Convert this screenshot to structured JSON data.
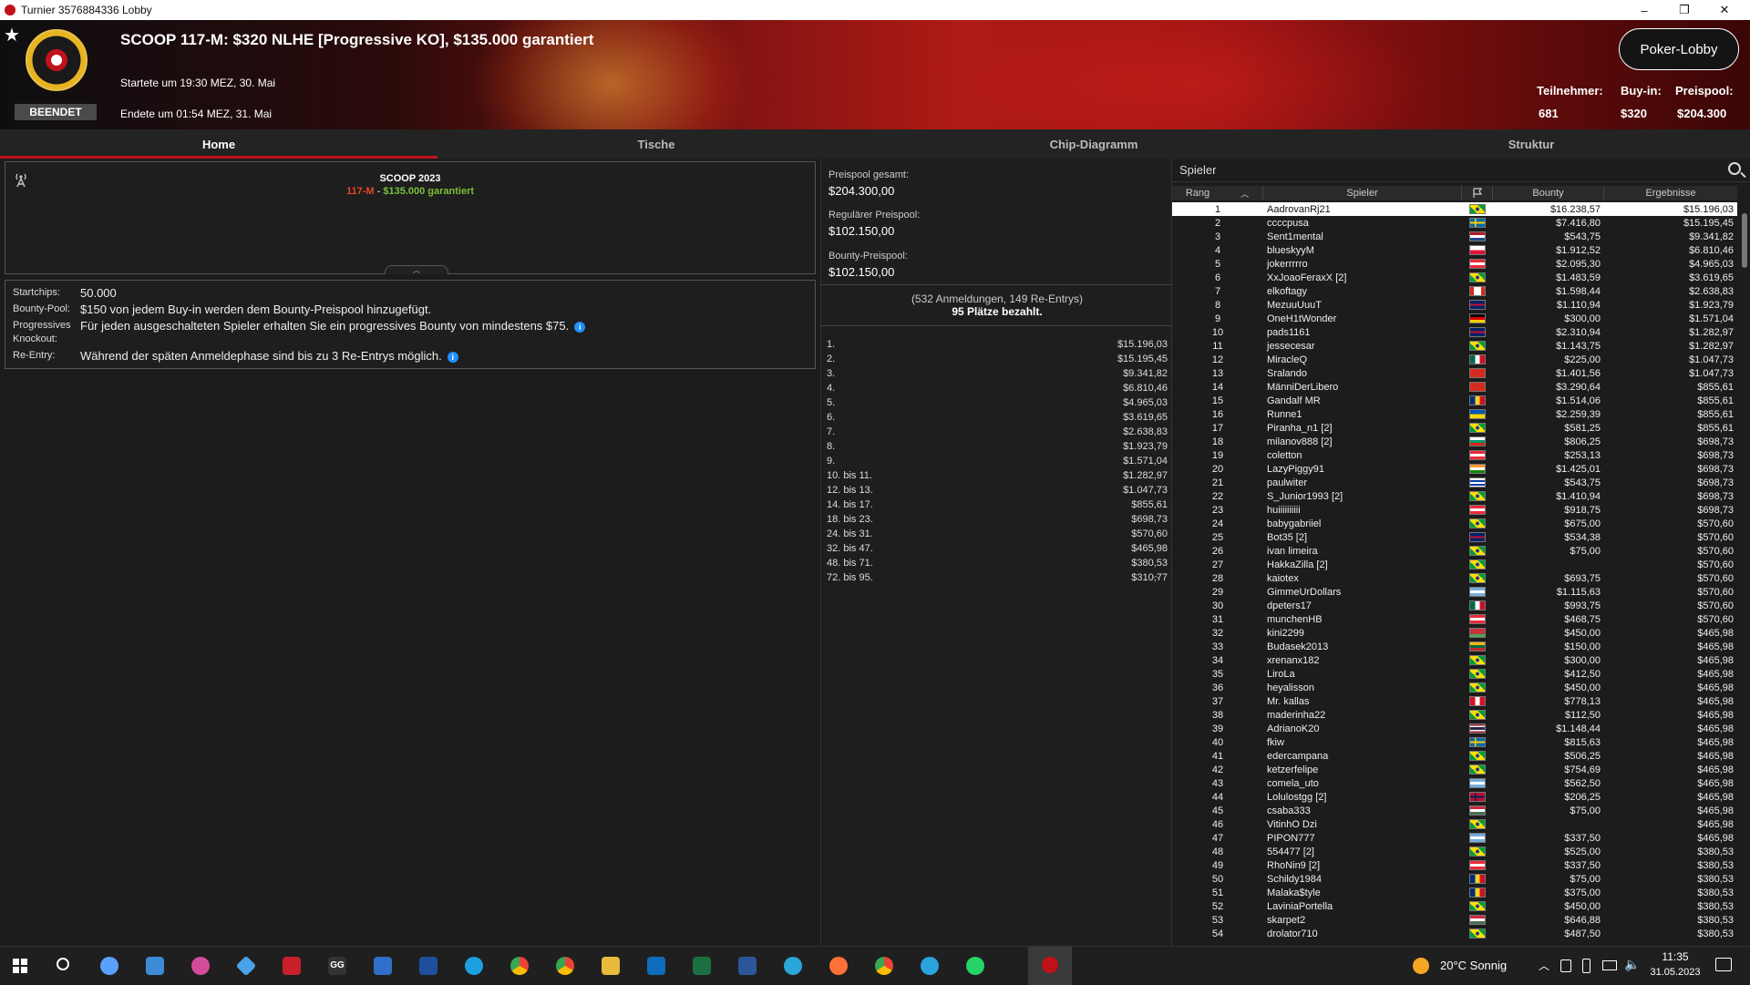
{
  "window": {
    "title": "Turnier 3576884336 Lobby",
    "minimize": "–",
    "maximize": "❐",
    "close": "✕"
  },
  "header": {
    "star": "★",
    "status": "BEENDET",
    "title": "SCOOP 117-M: $320 NLHE [Progressive KO], $135.000 garantiert",
    "started": "Startete um 19:30 MEZ, 30. Mai",
    "ended": "Endete um 01:54 MEZ, 31. Mai",
    "lobby_button": "Poker-Lobby",
    "stats": {
      "participants_label": "Teilnehmer:",
      "participants": "681",
      "buyin_label": "Buy-in:",
      "buyin": "$320",
      "prizepool_label": "Preispool:",
      "prizepool": "$204.300"
    }
  },
  "tabs": [
    "Home",
    "Tische",
    "Chip-Diagramm",
    "Struktur"
  ],
  "series": {
    "name": "SCOOP 2023",
    "event": "117-M",
    "sep": " - ",
    "guarantee": "$135.000 garantiert"
  },
  "details": [
    {
      "label": "Startchips:",
      "value": "50.000",
      "info": false
    },
    {
      "label": "Bounty-Pool:",
      "value": "$150 von jedem Buy-in werden dem Bounty-Preispool hinzugefügt.",
      "info": false
    },
    {
      "label": "Progressives Knockout:",
      "value": "Für jeden ausgeschalteten Spieler erhalten Sie ein progressives Bounty von mindestens $75.",
      "info": true
    },
    {
      "label": "Re-Entry:",
      "value": "Während der späten Anmeldephase sind bis zu 3 Re-Entrys möglich.",
      "info": true
    }
  ],
  "info_glyph": "i",
  "prizepool": {
    "total_label": "Preispool gesamt:",
    "total": "$204.300,00",
    "regular_label": "Regulärer Preispool:",
    "regular": "$102.150,00",
    "bounty_label": "Bounty-Preispool:",
    "bounty": "$102.150,00",
    "registrations": "(532 Anmeldungen, 149 Re-Entrys)",
    "paid": "95 Plätze bezahlt."
  },
  "payouts": [
    [
      "1.",
      "$15.196,03"
    ],
    [
      "2.",
      "$15.195,45"
    ],
    [
      "3.",
      "$9.341,82"
    ],
    [
      "4.",
      "$6.810,46"
    ],
    [
      "5.",
      "$4.965,03"
    ],
    [
      "6.",
      "$3.619,65"
    ],
    [
      "7.",
      "$2.638,83"
    ],
    [
      "8.",
      "$1.923,79"
    ],
    [
      "9.",
      "$1.571,04"
    ],
    [
      "10. bis 11.",
      "$1.282,97"
    ],
    [
      "12. bis 13.",
      "$1.047,73"
    ],
    [
      "14. bis 17.",
      "$855,61"
    ],
    [
      "18. bis 23.",
      "$698,73"
    ],
    [
      "24. bis 31.",
      "$570,60"
    ],
    [
      "32. bis 47.",
      "$465,98"
    ],
    [
      "48. bis 71.",
      "$380,53"
    ],
    [
      "72. bis 95.",
      "$310,77"
    ]
  ],
  "players_panel": {
    "title": "Spieler",
    "columns": [
      "Rang",
      "Spieler",
      "",
      "Bounty",
      "Ergebnisse"
    ]
  },
  "players": [
    [
      "1",
      "AadrovanRj21",
      "br",
      "$16.238,57",
      "$15.196,03"
    ],
    [
      "2",
      "ccccpusa",
      "se",
      "$7.416,80",
      "$15.195,45"
    ],
    [
      "3",
      "Sent1mental",
      "nl",
      "$543,75",
      "$9.341,82"
    ],
    [
      "4",
      "blueskyyM",
      "pl",
      "$1.912,52",
      "$6.810,46"
    ],
    [
      "5",
      "jokerrrrro",
      "at",
      "$2.095,30",
      "$4.965,03"
    ],
    [
      "6",
      "XxJoaoFeraxX [2]",
      "br",
      "$1.483,59",
      "$3.619,65"
    ],
    [
      "7",
      "elkoftagy",
      "ca",
      "$1.598,44",
      "$2.638,83"
    ],
    [
      "8",
      "MezuuUuuT",
      "gb",
      "$1.110,94",
      "$1.923,79"
    ],
    [
      "9",
      "OneH1tWonder",
      "de",
      "$300,00",
      "$1.571,04"
    ],
    [
      "10",
      "pads1161",
      "gb",
      "$2.310,94",
      "$1.282,97"
    ],
    [
      "11",
      "jessecesar",
      "br",
      "$1.143,75",
      "$1.282,97"
    ],
    [
      "12",
      "MiracleQ",
      "mx",
      "$225,00",
      "$1.047,73"
    ],
    [
      "13",
      "Sralando",
      "ch",
      "$1.401,56",
      "$1.047,73"
    ],
    [
      "14",
      "MänniDerLibero",
      "ch",
      "$3.290,64",
      "$855,61"
    ],
    [
      "15",
      "Gandalf MR",
      "ro",
      "$1.514,06",
      "$855,61"
    ],
    [
      "16",
      "Runne1",
      "ua",
      "$2.259,39",
      "$855,61"
    ],
    [
      "17",
      "Piranha_n1 [2]",
      "br",
      "$581,25",
      "$855,61"
    ],
    [
      "18",
      "milanov888 [2]",
      "bg",
      "$806,25",
      "$698,73"
    ],
    [
      "19",
      "coletton",
      "at",
      "$253,13",
      "$698,73"
    ],
    [
      "20",
      "LazyPiggy91",
      "in",
      "$1.425,01",
      "$698,73"
    ],
    [
      "21",
      "paulwiter",
      "uy",
      "$543,75",
      "$698,73"
    ],
    [
      "22",
      "S_Junior1993 [2]",
      "br",
      "$1.410,94",
      "$698,73"
    ],
    [
      "23",
      "huiiiiiiiiii",
      "at",
      "$918,75",
      "$698,73"
    ],
    [
      "24",
      "babygabriiel",
      "br",
      "$675,00",
      "$570,60"
    ],
    [
      "25",
      "Bot35 [2]",
      "gb",
      "$534,38",
      "$570,60"
    ],
    [
      "26",
      "ivan limeira",
      "br",
      "$75,00",
      "$570,60"
    ],
    [
      "27",
      "HakkaZilla [2]",
      "br",
      "",
      "$570,60"
    ],
    [
      "28",
      "kaiotex",
      "br",
      "$693,75",
      "$570,60"
    ],
    [
      "29",
      "GimmeUrDollars",
      "ar",
      "$1.115,63",
      "$570,60"
    ],
    [
      "30",
      "dpeters17",
      "mx",
      "$993,75",
      "$570,60"
    ],
    [
      "31",
      "munchenHB",
      "at",
      "$468,75",
      "$570,60"
    ],
    [
      "32",
      "kini2299",
      "by",
      "$450,00",
      "$465,98"
    ],
    [
      "33",
      "Budasek2013",
      "lt",
      "$150,00",
      "$465,98"
    ],
    [
      "34",
      "xrenanx182",
      "br",
      "$300,00",
      "$465,98"
    ],
    [
      "35",
      "LiroLa",
      "br",
      "$412,50",
      "$465,98"
    ],
    [
      "36",
      "heyalisson",
      "br",
      "$450,00",
      "$465,98"
    ],
    [
      "37",
      "Mr. kallas",
      "pe",
      "$778,13",
      "$465,98"
    ],
    [
      "38",
      "maderinha22",
      "br",
      "$112,50",
      "$465,98"
    ],
    [
      "39",
      "AdrianoK20",
      "th",
      "$1.148,44",
      "$465,98"
    ],
    [
      "40",
      "fkiw",
      "se",
      "$815,63",
      "$465,98"
    ],
    [
      "41",
      "edercampana",
      "br",
      "$506,25",
      "$465,98"
    ],
    [
      "42",
      "ketzerfelipe",
      "br",
      "$754,69",
      "$465,98"
    ],
    [
      "43",
      "comela_uto",
      "ar",
      "$562,50",
      "$465,98"
    ],
    [
      "44",
      "Lolulostgg [2]",
      "no",
      "$206,25",
      "$465,98"
    ],
    [
      "45",
      "csaba333",
      "hu",
      "$75,00",
      "$465,98"
    ],
    [
      "46",
      "VitinhO Dzi",
      "br",
      "",
      "$465,98"
    ],
    [
      "47",
      "PIPON777",
      "ar",
      "$337,50",
      "$465,98"
    ],
    [
      "48",
      "554477 [2]",
      "br",
      "$525,00",
      "$380,53"
    ],
    [
      "49",
      "RhoNin9 [2]",
      "at",
      "$337,50",
      "$380,53"
    ],
    [
      "50",
      "Schildy1984",
      "ro",
      "$75,00",
      "$380,53"
    ],
    [
      "51",
      "Malaka$tyle",
      "ro",
      "$375,00",
      "$380,53"
    ],
    [
      "52",
      "LaviniaPortella",
      "br",
      "$450,00",
      "$380,53"
    ],
    [
      "53",
      "skarpet2",
      "hu",
      "$646,88",
      "$380,53"
    ],
    [
      "54",
      "drolator710",
      "br",
      "$487,50",
      "$380,53"
    ]
  ],
  "taskbar": {
    "weather": "20°C Sonnig",
    "time": "11:35",
    "date": "31.05.2023"
  }
}
